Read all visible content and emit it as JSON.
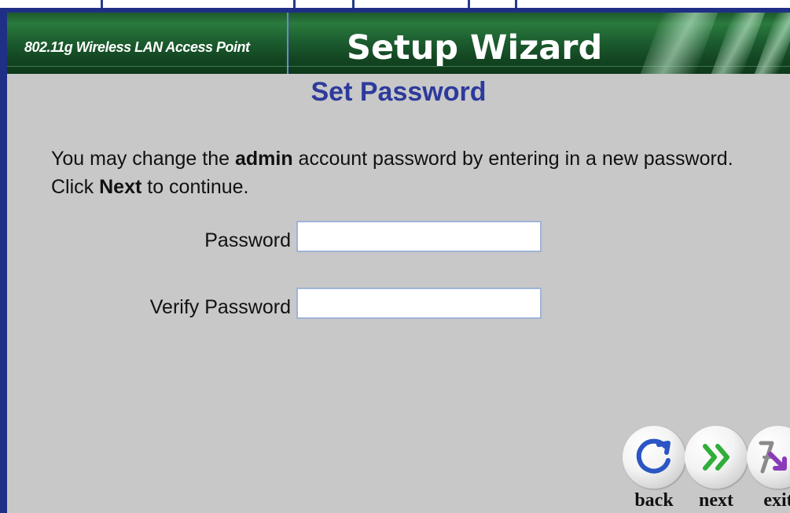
{
  "header": {
    "product_name": "802.11g Wireless LAN Access Point",
    "wizard_title": "Setup Wizard"
  },
  "page": {
    "heading": "Set Password",
    "instructions": {
      "part1": "You may change the ",
      "bold1": "admin",
      "part2": " account password by entering in a new password. Click ",
      "bold2": "Next",
      "part3": " to continue."
    }
  },
  "form": {
    "password_label": "Password",
    "password_value": "",
    "verify_label": "Verify Password",
    "verify_value": ""
  },
  "nav": {
    "back_label": "back",
    "next_label": "next",
    "exit_label": "exit"
  },
  "colors": {
    "frame": "#1f2f86",
    "banner": "#1d5f30",
    "heading": "#2d3a9c",
    "background": "#c8c8c8"
  },
  "icons": {
    "back": "circular-arrow-icon",
    "next": "double-chevron-right-icon",
    "exit": "exit-arrow-icon"
  }
}
